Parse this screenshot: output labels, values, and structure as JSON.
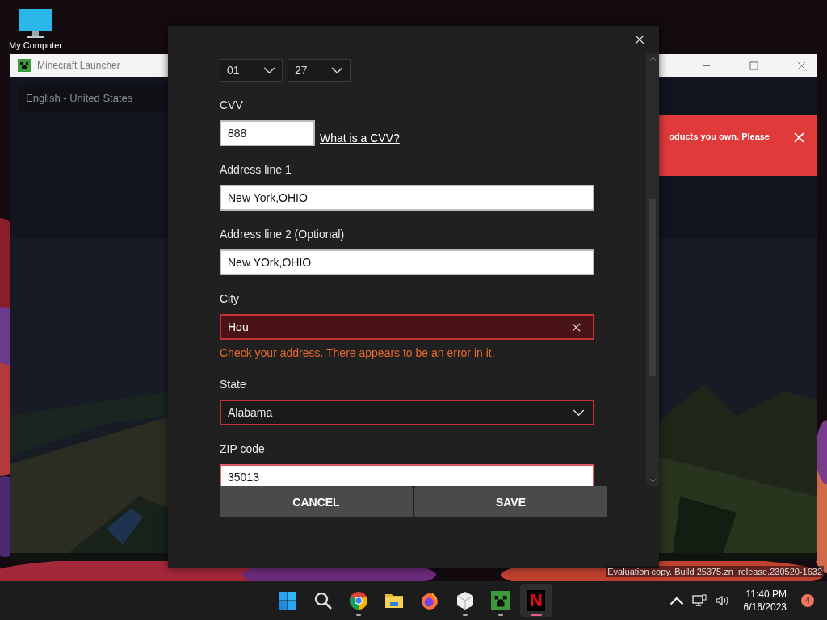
{
  "desktop": {
    "icons": [
      {
        "label": "My Computer"
      }
    ]
  },
  "launcher": {
    "title": "Minecraft Launcher",
    "language": "English - United States",
    "banner": {
      "text": "oducts you own. Please"
    }
  },
  "dialog": {
    "expiry": [
      {
        "value": "01"
      },
      {
        "value": "27"
      }
    ],
    "fields": [
      {
        "kind": "input",
        "label": "CVV",
        "value": "888",
        "link": "What is a CVV?",
        "error": false
      },
      {
        "kind": "input",
        "label": "Address line 1",
        "value": "New York,OHIO",
        "error": false
      },
      {
        "kind": "input",
        "label": "Address line 2 (Optional)",
        "value": "New YOrk,OHIO",
        "error": false
      },
      {
        "kind": "input",
        "label": "City",
        "value": "Hou",
        "error": true,
        "focused": true,
        "clearable": true,
        "message": "Check your address. There appears to be an error in it."
      },
      {
        "kind": "select",
        "label": "State",
        "value": "Alabama",
        "error": true
      },
      {
        "kind": "input",
        "label": "ZIP code",
        "value": "35013",
        "error": true
      }
    ],
    "buttons": [
      {
        "label": "CANCEL"
      },
      {
        "label": "SAVE"
      }
    ]
  },
  "watermark": "Evaluation copy. Build 25375.zn_release.230520-1632",
  "taskbar": {
    "apps": [
      {
        "kind": "start",
        "running": false,
        "active": false
      },
      {
        "kind": "search",
        "running": false,
        "active": false
      },
      {
        "kind": "chrome",
        "running": true,
        "active": false
      },
      {
        "kind": "folder",
        "running": false,
        "active": false
      },
      {
        "kind": "firefox",
        "running": false,
        "active": false
      },
      {
        "kind": "cube",
        "running": true,
        "active": false
      },
      {
        "kind": "creeper",
        "running": true,
        "active": false
      },
      {
        "kind": "letter",
        "glyph": "N",
        "running": true,
        "active": true
      }
    ],
    "clock": {
      "time": "11:40 PM",
      "date": "6/16/2023"
    },
    "notification_count": "4"
  }
}
